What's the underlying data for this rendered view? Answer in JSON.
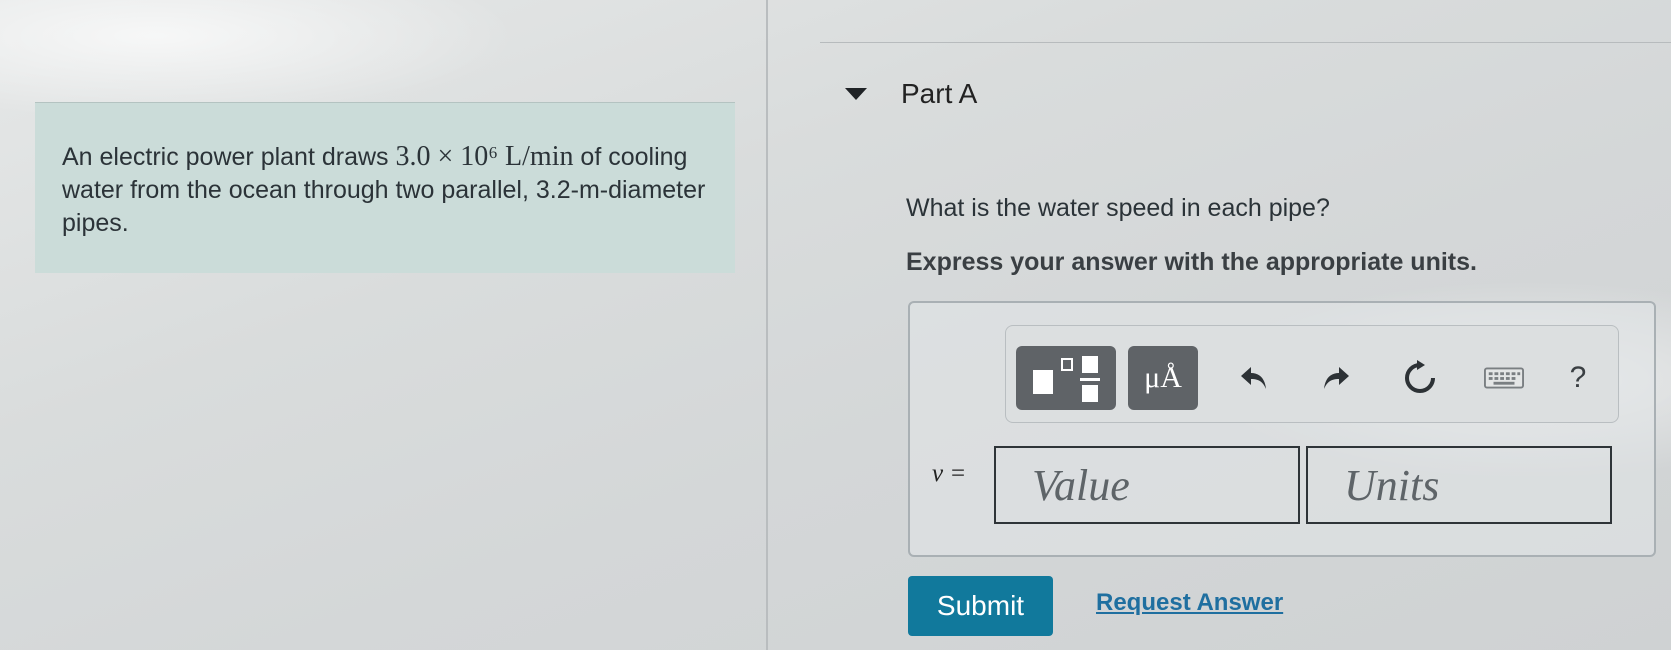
{
  "problem": {
    "text_before": "An electric power plant draws ",
    "math_rate": "3.0 × 10⁶ L/min",
    "text_after": " of cooling water from the ocean through two parallel, 3.2-m-diameter pipes."
  },
  "part": {
    "title": "Part A",
    "question": "What is the water speed in each pipe?",
    "instruction": "Express your answer with the appropriate units."
  },
  "toolbar": {
    "units_label": "μÅ",
    "help_label": "?"
  },
  "answer": {
    "variable_label": "v =",
    "value_placeholder": "Value",
    "units_placeholder": "Units"
  },
  "actions": {
    "submit_label": "Submit",
    "request_answer_label": "Request Answer"
  },
  "colors": {
    "problem_background": "#cbdcd9",
    "submit_background": "#11799c",
    "link_color": "#1f6fa0",
    "toolbar_button": "#5f6367"
  },
  "icons": {
    "collapse": "caret-down-icon",
    "template": "template-icon",
    "undo": "undo-icon",
    "redo": "redo-icon",
    "reset": "reset-icon",
    "keyboard": "keyboard-icon"
  }
}
